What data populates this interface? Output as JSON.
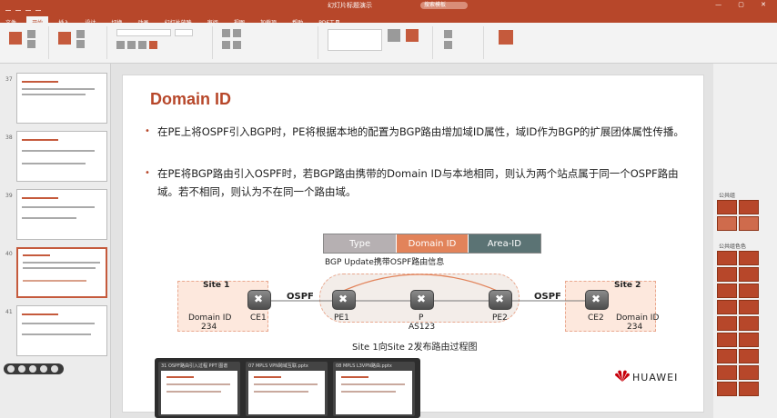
{
  "app": {
    "doc_title": "幻灯片标题演示",
    "search_placeholder": "搜索模板",
    "tabs": [
      "文件",
      "开始",
      "插入",
      "设计",
      "切换",
      "动画",
      "幻灯片放映",
      "审阅",
      "视图",
      "加载项",
      "帮助",
      "PDF工具"
    ],
    "active_tab": "开始"
  },
  "slide": {
    "title": "Domain ID",
    "bullets": [
      "在PE上将OSPF引入BGP时，PE将根据本地的配置为BGP路由增加域ID属性，域ID作为BGP的扩展团体属性传播。",
      "在PE将BGP路由引入OSPF时，若BGP路由携带的Domain  ID与本地相同，则认为两个站点属于同一个OSPF路由域。若不相同，则认为不在同一个路由域。"
    ],
    "attr_bar": [
      "Type",
      "Domain ID",
      "Area-ID"
    ],
    "bgp_note": "BGP Update携带OSPF路由信息",
    "diagram": {
      "site1": "Site 1",
      "site2": "Site 2",
      "domain_left": "Domain ID",
      "domain_left_val": "234",
      "domain_right": "Domain ID",
      "domain_right_val": "234",
      "ospf_left": "OSPF",
      "ospf_right": "OSPF",
      "ce1": "CE1",
      "pe1": "PE1",
      "p": "P",
      "as": "AS123",
      "pe2": "PE2",
      "ce2": "CE2"
    },
    "caption": "Site 1向Site 2发布路由过程图",
    "brand": "HUAWEI"
  },
  "thumbnails": {
    "numbers": [
      "37",
      "38",
      "39",
      "40",
      "41"
    ],
    "active_index": 3
  },
  "right_panel": {
    "label_a": "公共组",
    "label_b": "公共组色色"
  },
  "task_preview": [
    "31 OSPF路由引入过程 PPT 图谱",
    "07 MPLS VPN跨域互联.pptx",
    "08 MPLS L3VPN路由.pptx"
  ],
  "colors": {
    "accent": "#b7472a",
    "domain_seg": "#e2835a",
    "area_seg": "#5b7374",
    "type_seg": "#b6b0b2"
  }
}
